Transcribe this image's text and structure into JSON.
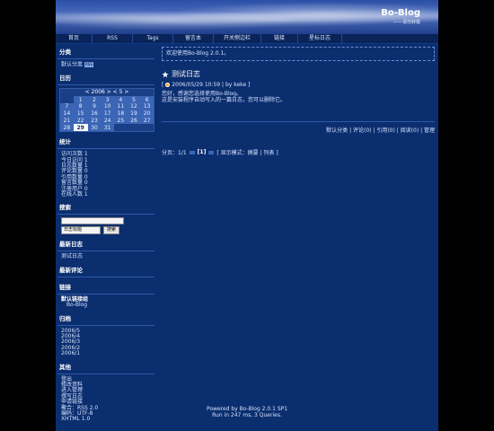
{
  "header": {
    "title": "Bo-Blog",
    "subtitle": "——请勿转载"
  },
  "nav": {
    "items": [
      "首页",
      "RSS",
      "Tags",
      "留言本",
      "开关侧边栏",
      "链接",
      "星标日志"
    ]
  },
  "sidebar": {
    "category": {
      "title": "分类",
      "item": "默认分类",
      "badge": "RSS"
    },
    "calendar": {
      "title": "日历",
      "month_label": "< 2006 >  < 5 >",
      "weeks": [
        [
          "",
          "1",
          "2",
          "3",
          "4",
          "5",
          "6"
        ],
        [
          "7",
          "8",
          "9",
          "10",
          "11",
          "12",
          "13"
        ],
        [
          "14",
          "15",
          "16",
          "17",
          "18",
          "19",
          "20"
        ],
        [
          "21",
          "22",
          "23",
          "24",
          "25",
          "26",
          "27"
        ],
        [
          "28",
          "29",
          "30",
          "31",
          "",
          "",
          ""
        ]
      ],
      "today": "29"
    },
    "stats": {
      "title": "统计",
      "items": [
        "访问次数 1",
        "今日访问 1",
        "日志数量 1",
        "评论数量 0",
        "引用数量 0",
        "留言数量 0",
        "注册用户 0",
        "在线人数 1"
      ]
    },
    "search": {
      "title": "搜索",
      "select_value": "日志标题",
      "button": "搜索"
    },
    "recent_posts": {
      "title": "最新日志",
      "items": [
        "测试日志"
      ]
    },
    "recent_comments": {
      "title": "最新评论"
    },
    "links": {
      "title": "链接",
      "group": "默认链接组",
      "items": [
        "Bo-Blog"
      ]
    },
    "archive": {
      "title": "归档",
      "items": [
        "2006/5",
        "2006/4",
        "2006/3",
        "2006/2",
        "2006/1"
      ]
    },
    "misc": {
      "title": "其他",
      "items": [
        "登出",
        "修改资料",
        "进入管理",
        "撰写日志",
        "申请链接",
        "聚合：RSS 2.0",
        "编码：UTF-8",
        "XHTML 1.0"
      ]
    }
  },
  "main": {
    "welcome": "欢迎使用Bo-Blog 2.0.1。",
    "post": {
      "title": "测试日志",
      "meta": "2006/05/29 10:59 | by keke ]",
      "meta_prefix": "[",
      "body_line1": "您好，感谢您选择使用Bo-Blog。",
      "body_line2": "这是安装程序自动写入的一篇日志，您可以删除它。",
      "footer": "默认分类 | 评论(0) | 引用(0) | 阅读(0) | 管理"
    },
    "pager": {
      "prefix": "分页：1/1",
      "current": "[1]",
      "display": "[ 显示模式：摘要 | 列表 ]"
    }
  },
  "footer": {
    "line1": "Powered by Bo-Blog 2.0.1 SP1",
    "line2": "Run in 247 ms, 3 Queries."
  },
  "colors": {
    "background": "#0b2e6f",
    "nav": "#0a245a",
    "outer": "#000000"
  }
}
